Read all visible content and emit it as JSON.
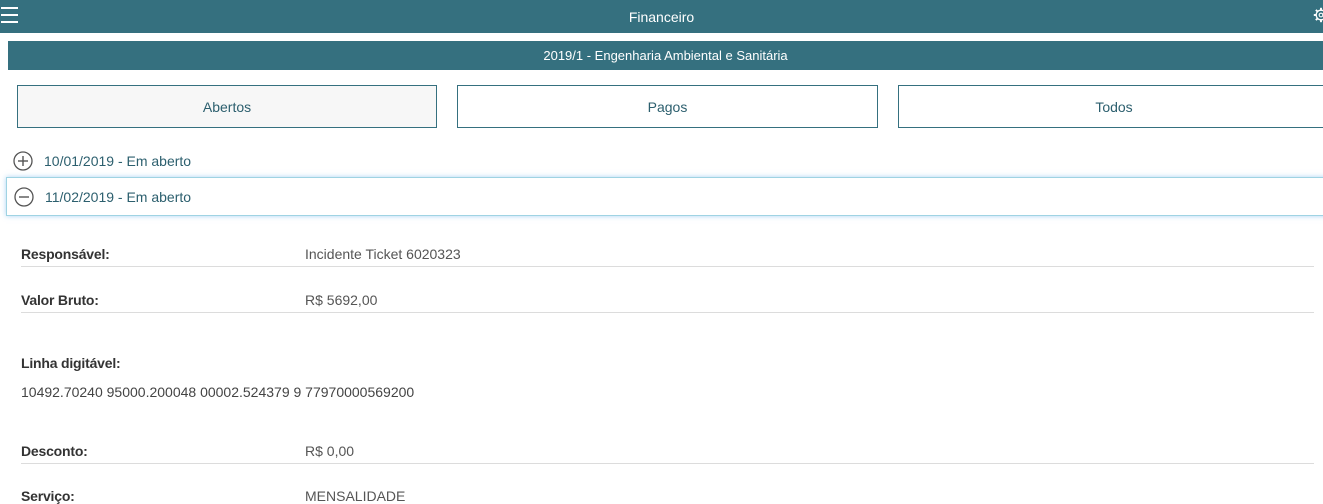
{
  "header": {
    "title": "Financeiro",
    "course": "2019/1 - Engenharia Ambiental e Sanitária"
  },
  "tabs": [
    {
      "label": "Abertos",
      "active": true
    },
    {
      "label": "Pagos",
      "active": false
    },
    {
      "label": "Todos",
      "active": false
    }
  ],
  "installments": [
    {
      "label": "10/01/2019 - Em aberto",
      "expanded": false
    },
    {
      "label": "11/02/2019 - Em aberto",
      "expanded": true
    }
  ],
  "details": {
    "responsavel_label": "Responsável:",
    "responsavel_value": "Incidente Ticket 6020323",
    "valor_bruto_label": "Valor Bruto:",
    "valor_bruto_value": "R$ 5692,00",
    "linha_label": "Linha digitável:",
    "linha_value": "10492.70240 95000.200048 00002.524379 9 77970000569200",
    "desconto_label": "Desconto:",
    "desconto_value": "R$ 0,00",
    "servico_label": "Serviço:",
    "servico_value": "MENSALIDADE"
  },
  "colors": {
    "brand": "#35707f",
    "accent_text": "#2c5f6e"
  },
  "icons": [
    "menu-icon",
    "gear-icon",
    "plus-circle-icon",
    "minus-circle-icon"
  ]
}
